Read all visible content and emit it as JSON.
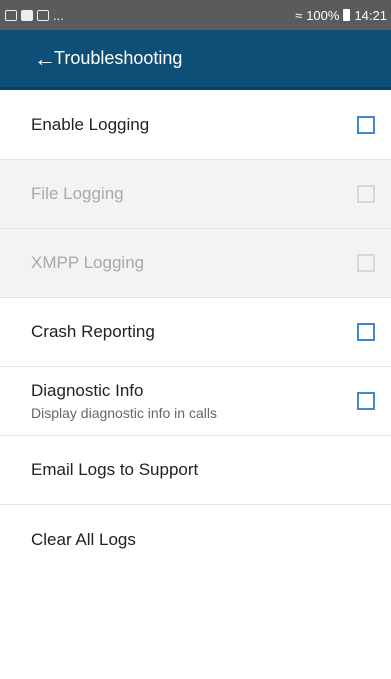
{
  "status_bar": {
    "left_icons": [
      "image-icon",
      "mail-icon",
      "gallery-icon"
    ],
    "overflow": "...",
    "signal": "≈",
    "battery": "100%",
    "time": "14:21"
  },
  "app_bar": {
    "back": "←",
    "title": "Troubleshooting"
  },
  "settings": [
    {
      "label": "Enable Logging",
      "enabled": true,
      "checked": false
    },
    {
      "label": "File Logging",
      "enabled": false,
      "checked": false
    },
    {
      "label": "XMPP Logging",
      "enabled": false,
      "checked": false
    },
    {
      "label": "Crash Reporting",
      "enabled": true,
      "checked": false
    },
    {
      "label": "Diagnostic Info",
      "description": "Display diagnostic info in calls",
      "enabled": true,
      "checked": false
    }
  ],
  "actions": [
    {
      "label": "Email Logs to Support"
    },
    {
      "label": "Clear All Logs"
    }
  ],
  "colors": {
    "status_bar": "#5b5b5b",
    "app_bar": "#0e4f78",
    "checkbox": "#3f87cf"
  }
}
